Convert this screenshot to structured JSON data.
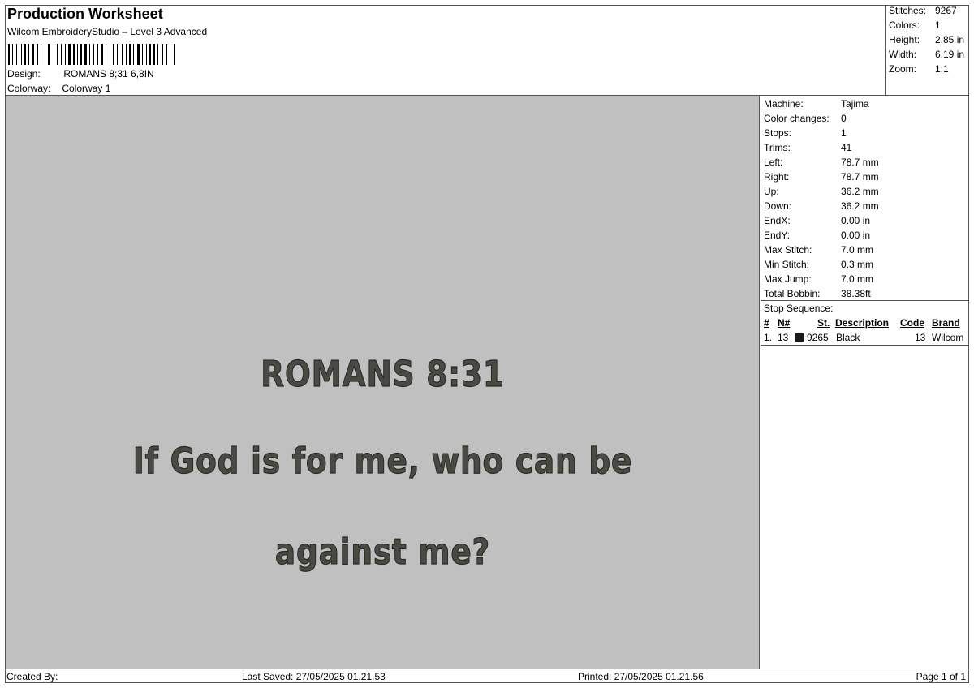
{
  "header": {
    "title": "Production Worksheet",
    "software": "Wilcom EmbroideryStudio – Level 3 Advanced",
    "design_label": "Design:",
    "design_value": "ROMANS 8;31 6,8IN",
    "colorway_label": "Colorway:",
    "colorway_value": "Colorway 1"
  },
  "summary": {
    "stitches_label": "Stitches:",
    "stitches_value": "9267",
    "colors_label": "Colors:",
    "colors_value": "1",
    "height_label": "Height:",
    "height_value": "2.85 in",
    "width_label": "Width:",
    "width_value": "6.19 in",
    "zoom_label": "Zoom:",
    "zoom_value": "1:1"
  },
  "preview": {
    "line1": "ROMANS 8:31",
    "line2": "If God is for me, who can be",
    "line3": "against me?",
    "background_color": "#c0c0c0",
    "thread_color": "#4a4a44"
  },
  "machine_info": [
    {
      "label": "Machine:",
      "value": "Tajima"
    },
    {
      "label": "Color changes:",
      "value": "0"
    },
    {
      "label": "Stops:",
      "value": "1"
    },
    {
      "label": "Trims:",
      "value": "41"
    },
    {
      "label": "Left:",
      "value": "78.7 mm"
    },
    {
      "label": "Right:",
      "value": "78.7 mm"
    },
    {
      "label": "Up:",
      "value": "36.2 mm"
    },
    {
      "label": "Down:",
      "value": "36.2 mm"
    },
    {
      "label": "EndX:",
      "value": "0.00 in"
    },
    {
      "label": "EndY:",
      "value": "0.00 in"
    },
    {
      "label": "Max Stitch:",
      "value": "7.0 mm"
    },
    {
      "label": "Min Stitch:",
      "value": "0.3 mm"
    },
    {
      "label": "Max Jump:",
      "value": "7.0 mm"
    },
    {
      "label": "Total Bobbin:",
      "value": "38.38ft"
    }
  ],
  "stop_sequence": {
    "title": "Stop Sequence:",
    "headers": {
      "num": "#",
      "n": "N#",
      "st": "St.",
      "description": "Description",
      "code": "Code",
      "brand": "Brand"
    },
    "rows": [
      {
        "num": "1.",
        "n": "13",
        "st": "9265",
        "description": "Black",
        "code": "13",
        "brand": "Wilcom",
        "color": "#1a1a1a"
      }
    ]
  },
  "footer": {
    "created_by": "Created By:",
    "last_saved": "Last Saved: 27/05/2025 01.21.53",
    "printed": "Printed: 27/05/2025 01.21.56",
    "page": "Page 1 of 1"
  }
}
